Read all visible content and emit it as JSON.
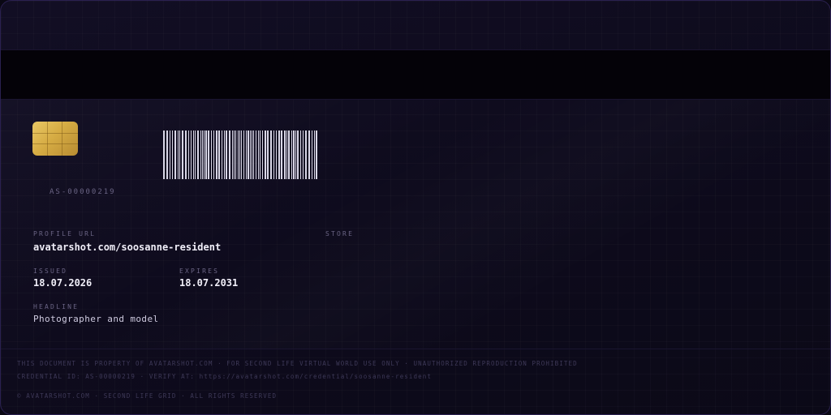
{
  "card": {
    "credential_number": "AS-00000219",
    "profile_url": {
      "label": "PROFILE URL",
      "value": "avatarshot.com/soosanne-resident"
    },
    "store": {
      "label": "STORE",
      "value": ""
    },
    "issued": {
      "label": "ISSUED",
      "value": "18.07.2026"
    },
    "expires": {
      "label": "EXPIRES",
      "value": "18.07.2031"
    },
    "headline": {
      "label": "HEADLINE",
      "value": "Photographer and model"
    }
  },
  "footer": {
    "legal": "THIS DOCUMENT IS PROPERTY OF AVATARSHOT.COM · FOR SECOND LIFE VIRTUAL WORLD USE ONLY · UNAUTHORIZED REPRODUCTION PROHIBITED",
    "verify": "CREDENTIAL ID: AS-00000219 · VERIFY AT: https://avatarshot.com/credential/soosanne-resident",
    "copyright": "© AVATARSHOT.COM · SECOND LIFE GRID · ALL RIGHTS RESERVED"
  },
  "colors": {
    "background": "#0e0b1d",
    "stripe": "#040208",
    "chip_gold": "#d6ac44",
    "barcode": "#d8d6e6",
    "label": "#6a6484",
    "value": "#f0eef8"
  },
  "icons": {
    "chip": "smart-card-chip-icon",
    "barcode": "barcode-icon"
  }
}
